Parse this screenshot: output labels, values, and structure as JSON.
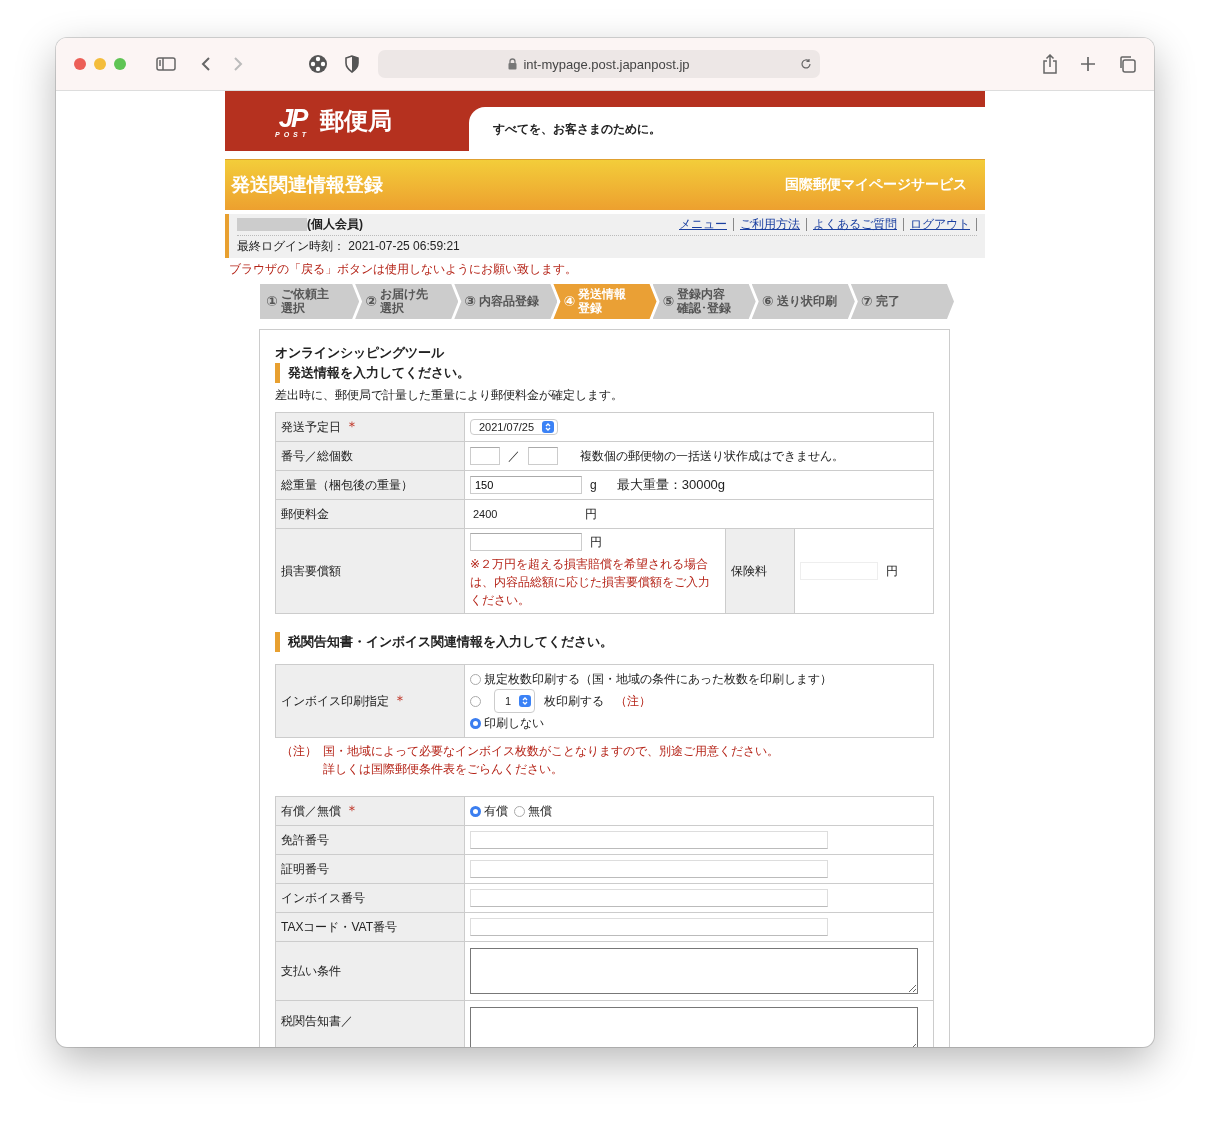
{
  "browser": {
    "url": "int-mypage.post.japanpost.jp"
  },
  "header": {
    "logo_mark": "JP",
    "logo_sub": "POST",
    "logo_text": "郵便局",
    "tagline": "すべてを、お客さまのために。"
  },
  "title_bar": {
    "title": "発送関連情報登録",
    "service": "国際郵便マイページサービス"
  },
  "user_bar": {
    "member_type": "(個人会員)",
    "links": [
      "メニュー",
      "ご利用方法",
      "よくあるご質問",
      "ログアウト"
    ],
    "last_login_label": "最終ログイン時刻：",
    "last_login": "2021-07-25 06:59:21"
  },
  "warning": "ブラウザの「戻る」ボタンは使用しないようにお願い致します。",
  "steps": [
    {
      "number": "①",
      "lines": [
        "ご依頼主",
        "選択"
      ],
      "selected": false
    },
    {
      "number": "②",
      "lines": [
        "お届け先",
        "選択"
      ],
      "selected": false
    },
    {
      "number": "③",
      "lines": [
        "内容品登録"
      ],
      "selected": false
    },
    {
      "number": "④",
      "lines": [
        "発送情報",
        "登録"
      ],
      "selected": true
    },
    {
      "number": "⑤",
      "lines": [
        "登録内容",
        "確認･登録"
      ],
      "selected": false
    },
    {
      "number": "⑥",
      "lines": [
        "送り状印刷"
      ],
      "selected": false
    },
    {
      "number": "⑦",
      "lines": [
        "完了"
      ],
      "selected": false
    }
  ],
  "form": {
    "app_title": "オンラインシッピングツール",
    "heading": "発送情報を入力してください。",
    "note": "差出時に、郵便局で計量した重量により郵便料金が確定します。",
    "shipping_rows": [
      {
        "kind": "select",
        "label": "発送予定日",
        "mark": "＊",
        "value": "2021/07/25"
      },
      {
        "kind": "pair",
        "label": "番号／総個数",
        "separator": "／",
        "note": "複数個の郵便物の一括送り状作成はできません。"
      },
      {
        "kind": "input_unit",
        "label": "総重量（梱包後の重量）",
        "value": "150",
        "unit": "g",
        "note": "最大重量：30000g"
      },
      {
        "kind": "text_unit",
        "label": "郵便料金",
        "value": "2400",
        "unit": "円"
      },
      {
        "kind": "damage",
        "label": "損害要償額",
        "unit": "円",
        "warning": "※２万円を超える損害賠償を希望される場合は、内容品総額に応じた損害要償額をご入力ください。",
        "side_label": "保険料",
        "side_unit": "円"
      }
    ],
    "invoice_heading": "税関告知書・インボイス関連情報を入力してください。",
    "invoice_row": {
      "label": "インボイス印刷指定",
      "mark": "＊",
      "options": [
        {
          "kind": "radio",
          "label": "規定枚数印刷する（国・地域の条件にあった枚数を印刷します）",
          "selected": false
        },
        {
          "kind": "radio_select",
          "select_value": "1",
          "label": "枚印刷する",
          "note": "（注）",
          "selected": false
        },
        {
          "kind": "radio",
          "label": "印刷しない",
          "selected": true
        }
      ]
    },
    "invoice_note": {
      "prefix": "（注）",
      "lines": [
        "国・地域によって必要なインボイス枚数がことなりますので、別途ご用意ください。",
        "詳しくは国際郵便条件表をごらんください。"
      ]
    },
    "detail_rows": [
      {
        "kind": "radio_group",
        "label": "有償／無償",
        "mark": "＊",
        "options": [
          {
            "label": "有償",
            "selected": true
          },
          {
            "label": "無償",
            "selected": false
          }
        ]
      },
      {
        "kind": "input",
        "label": "免許番号"
      },
      {
        "kind": "input",
        "label": "証明番号"
      },
      {
        "kind": "input",
        "label": "インボイス番号"
      },
      {
        "kind": "input",
        "label": "TAXコード・VAT番号"
      },
      {
        "kind": "textarea",
        "label": "支払い条件"
      },
      {
        "kind": "textarea",
        "label": "税関告知書／"
      }
    ]
  }
}
